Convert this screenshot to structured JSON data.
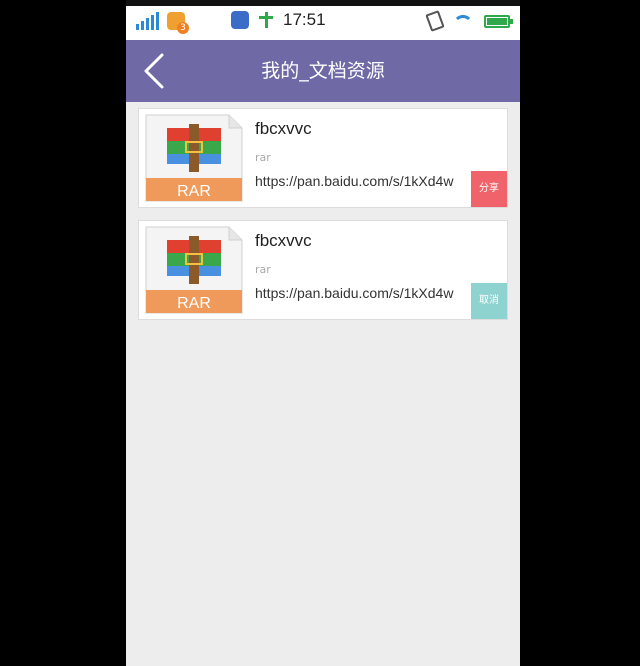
{
  "statusbar": {
    "notification_count": "3",
    "time": "17:51"
  },
  "header": {
    "title": "我的_文档资源"
  },
  "items": [
    {
      "name": "fbcxvvc",
      "type": "rar",
      "link": "https://pan.baidu.com/s/1kXd4w",
      "thumb_label": "RAR",
      "action_label": "分享"
    },
    {
      "name": "fbcxvvc",
      "type": "rar",
      "link": "https://pan.baidu.com/s/1kXd4w",
      "thumb_label": "RAR",
      "action_label": "取消"
    }
  ],
  "colors": {
    "header_bg": "#6f6aa6",
    "share_button": "#f0636a",
    "cancel_button": "#8fd3d0",
    "thumb_band": "#ef9a5a"
  },
  "icons": {
    "back": "chevron-left-icon",
    "file": "rar-archive-icon"
  }
}
